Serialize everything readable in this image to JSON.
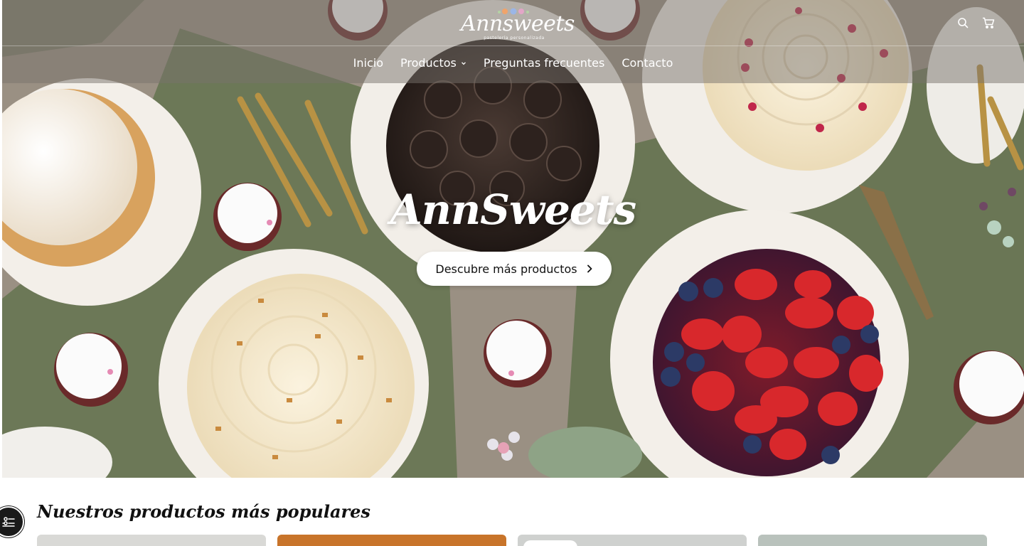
{
  "brand": {
    "logo_text": "Annsweets",
    "logo_tagline": "pastelería personalizada"
  },
  "nav": {
    "items": [
      {
        "label": "Inicio"
      },
      {
        "label": "Productos",
        "has_dropdown": true
      },
      {
        "label": "Preguntas frecuentes"
      },
      {
        "label": "Contacto"
      }
    ]
  },
  "header_icons": [
    "search-icon",
    "cart-icon"
  ],
  "hero": {
    "title": "AnnSweets",
    "cta_label": "Descubre más productos",
    "cta_icon": "chevron-right-icon"
  },
  "popular": {
    "title": "Nuestros productos más populares",
    "cards": [
      {
        "color": "#d9d9d6"
      },
      {
        "color": "#c8742a"
      },
      {
        "color": "#cfd1cf",
        "has_badge": true
      },
      {
        "color": "#b9c2bc"
      }
    ]
  },
  "filter_button": {
    "icon": "filter-sliders-icon"
  },
  "colors": {
    "header_overlay": "rgba(120,114,108,0.50)",
    "text_on_hero": "#ffffff",
    "cta_bg": "#ffffff",
    "placemat_green": "#6f7a58",
    "table_linen": "#9b9184"
  }
}
